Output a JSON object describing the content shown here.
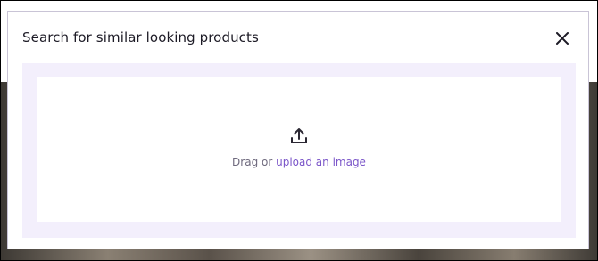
{
  "modal": {
    "title": "Search for similar looking products",
    "close_icon": "close-icon"
  },
  "dropzone": {
    "icon": "upload-icon",
    "prefix_text": "Drag or",
    "link_text": "upload an image"
  },
  "colors": {
    "accent": "#7b56c9",
    "dropzone_background": "#f3effc",
    "title_text": "#1d1b26",
    "muted_text": "#6f6a7e"
  }
}
